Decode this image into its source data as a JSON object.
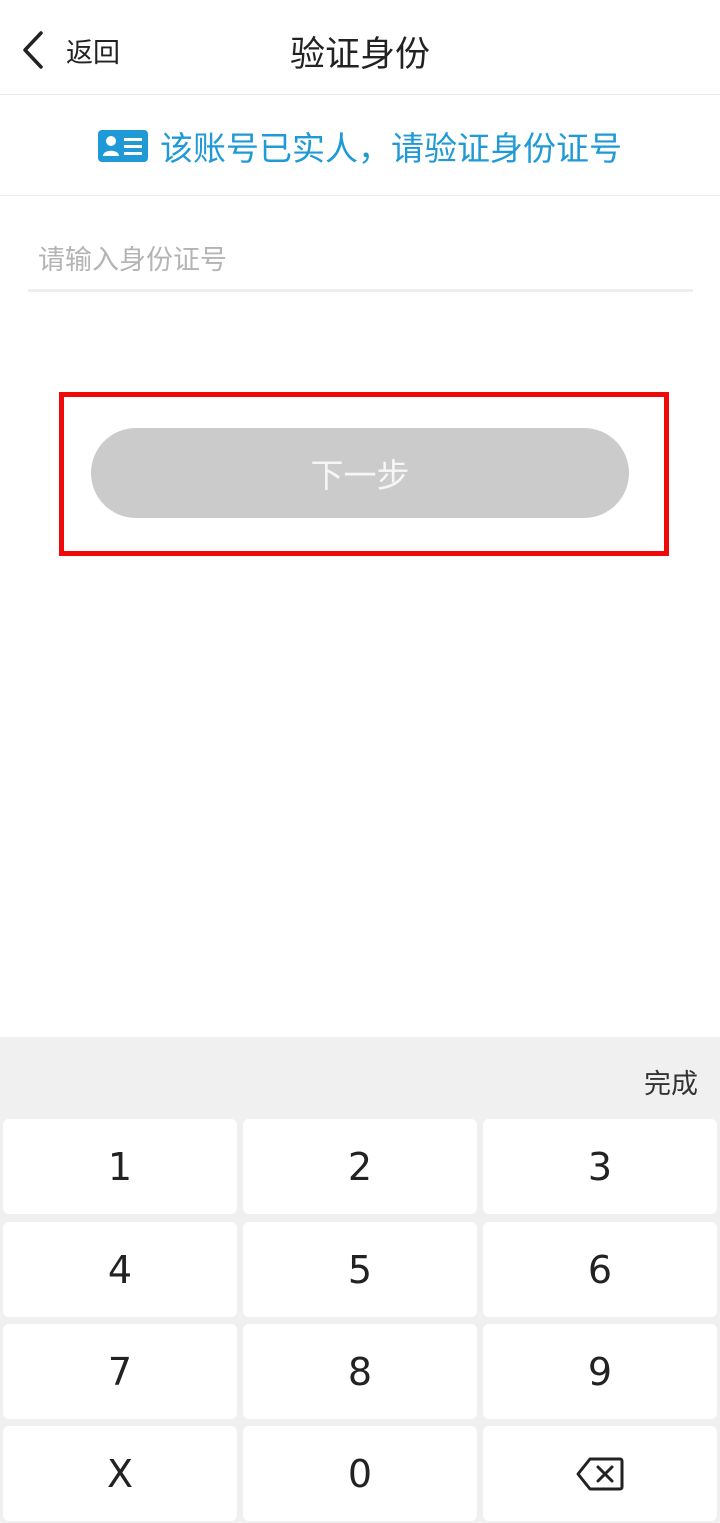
{
  "header": {
    "back_label": "返回",
    "title": "验证身份"
  },
  "notice": {
    "icon": "id-card-icon",
    "text": "该账号已实人，请验证身份证号",
    "color": "#1f9ad6"
  },
  "form": {
    "id_input": {
      "value": "",
      "placeholder": "请输入身份证号"
    },
    "next_button_label": "下一步"
  },
  "keyboard": {
    "done_label": "完成",
    "keys": [
      "1",
      "2",
      "3",
      "4",
      "5",
      "6",
      "7",
      "8",
      "9",
      "X",
      "0"
    ],
    "backspace_icon": "backspace-icon"
  },
  "colors": {
    "accent": "#1f9ad6",
    "highlight": "#ee0a0a",
    "button_disabled": "#cccbcb"
  }
}
